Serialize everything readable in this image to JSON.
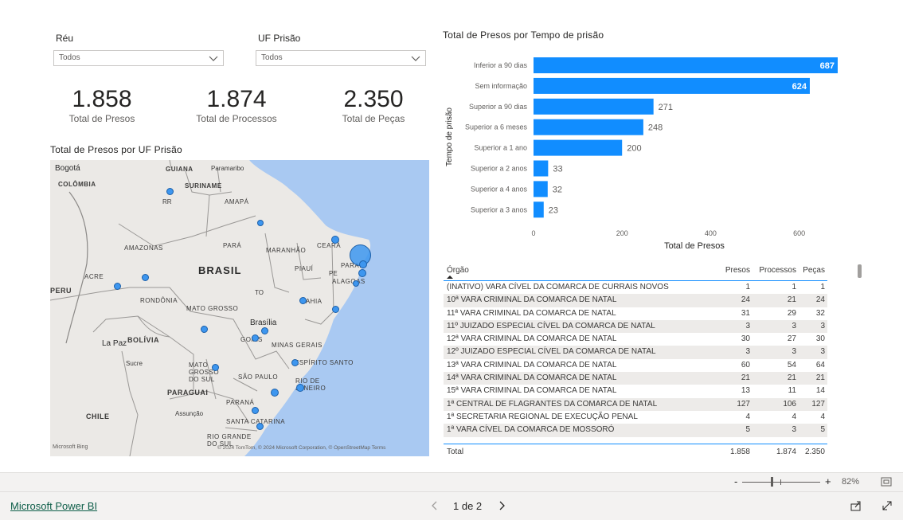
{
  "slicers": {
    "reu": {
      "label": "Réu",
      "value": "Todos"
    },
    "uf": {
      "label": "UF Prisão",
      "value": "Todos"
    }
  },
  "kpis": [
    {
      "value": "1.858",
      "label": "Total de Presos"
    },
    {
      "value": "1.874",
      "label": "Total de Processos"
    },
    {
      "value": "2.350",
      "label": "Total de Peças"
    }
  ],
  "map": {
    "title": "Total de Presos por UF Prisão",
    "labels": {
      "bogota": "Bogotá",
      "guiana": "GUIANA",
      "paramaribo": "Paramaribo",
      "colombia": "COLÔMBIA",
      "suriname": "SURINAME",
      "rr": "RR",
      "amapa": "AMAPÁ",
      "amazonas": "AMAZONAS",
      "para": "PARÁ",
      "maranhao": "MARANHÃO",
      "ceara": "CEARÁ",
      "acre": "ACRE",
      "brasil": "BRASIL",
      "piaui": "PIAUÍ",
      "pe": "PE",
      "parai": "PARAÍ",
      "alagoas": "ALAGOAS",
      "peru": "PERU",
      "rondonia": "RONDÔNIA",
      "to": "TO",
      "bahia": "BAHIA",
      "matogrosso": "MATO GROSSO",
      "brasilia": "Brasília",
      "goias": "GOIÁS",
      "lapaz": "La Paz",
      "bolivia": "BOLÍVIA",
      "minas": "MINAS GERAIS",
      "sucre": "Sucre",
      "espirito": "ESPÍRITO SANTO",
      "msul": "MATO GROSSO DO SUL",
      "saopaulo": "SÃO PAULO",
      "rio": "RIO DE JANEIRO",
      "paraguai": "PARAGUAI",
      "parana": "PARANÁ",
      "chile": "CHILE",
      "assuncao": "Assunção",
      "santacatarina": "SANTA CATARINA",
      "riogrande": "RIO GRANDE DO SUL"
    },
    "attribution": "© 2024 TomTom, © 2024 Microsoft Corporation, © OpenStreetMap  Terms",
    "bing": "Microsoft Bing"
  },
  "bar_chart": {
    "title": "Total de Presos por Tempo de prisão",
    "accent": "#118dff"
  },
  "chart_data": {
    "type": "bar",
    "orientation": "horizontal",
    "categories": [
      "Inferior a 90 dias",
      "Sem informação",
      "Superior a 90 dias",
      "Superior a 6 meses",
      "Superior a 1 ano",
      "Superior a 2 anos",
      "Superior a 4 anos",
      "Superior a 3 anos"
    ],
    "values": [
      687,
      624,
      271,
      248,
      200,
      33,
      32,
      23
    ],
    "xlabel": "Total de Presos",
    "ylabel": "Tempo de prisão",
    "xticks": [
      0,
      200,
      400,
      600
    ],
    "xlim": [
      0,
      687
    ],
    "grid": false,
    "color": "#118dff"
  },
  "table": {
    "headers": [
      "Órgão",
      "Presos",
      "Processos",
      "Peças"
    ],
    "rows": [
      [
        "(INATIVO) VARA CÍVEL DA COMARCA DE CURRAIS NOVOS",
        "1",
        "1",
        "1"
      ],
      [
        "10ª VARA CRIMINAL DA COMARCA DE NATAL",
        "24",
        "21",
        "24"
      ],
      [
        "11ª VARA CRIMINAL DA COMARCA DE NATAL",
        "31",
        "29",
        "32"
      ],
      [
        "11º JUIZADO ESPECIAL CÍVEL DA COMARCA DE NATAL",
        "3",
        "3",
        "3"
      ],
      [
        "12ª VARA CRIMINAL DA COMARCA DE NATAL",
        "30",
        "27",
        "30"
      ],
      [
        "12º JUIZADO ESPECIAL CÍVEL DA COMARCA DE NATAL",
        "3",
        "3",
        "3"
      ],
      [
        "13ª VARA CRIMINAL DA COMARCA DE NATAL",
        "60",
        "54",
        "64"
      ],
      [
        "14ª VARA CRIMINAL DA COMARCA DE NATAL",
        "21",
        "21",
        "21"
      ],
      [
        "15ª VARA CRIMINAL DA COMARCA DE NATAL",
        "13",
        "11",
        "14"
      ],
      [
        "1ª CENTRAL DE FLAGRANTES DA COMARCA DE NATAL",
        "127",
        "106",
        "127"
      ],
      [
        "1ª SECRETARIA REGIONAL DE EXECUÇÃO PENAL",
        "4",
        "4",
        "4"
      ],
      [
        "1ª VARA CÍVEL DA COMARCA DE MOSSORÓ",
        "5",
        "3",
        "5"
      ]
    ],
    "total": [
      "Total",
      "1.858",
      "1.874",
      "2.350"
    ]
  },
  "zoom": {
    "minus": "-",
    "plus": "+",
    "level": "82%"
  },
  "footer": {
    "brand": "Microsoft Power BI",
    "page": "1 de 2"
  }
}
